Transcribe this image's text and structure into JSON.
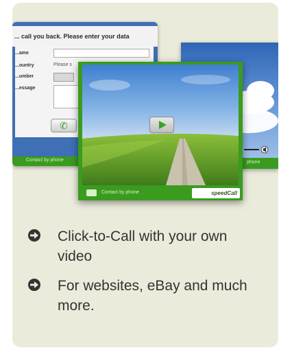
{
  "form_window": {
    "header": "... call you back. Please enter your data",
    "labels": [
      "...ame",
      "...ountry",
      "...umber",
      "...essage"
    ],
    "country_placeholder": "Please s",
    "footer_text": "Contact by phone"
  },
  "video_window": {
    "footer_text": "Contact by phone",
    "brand": "speedCall"
  },
  "sky_window": {
    "footer_text": "phone"
  },
  "features": [
    "Click-to-Call with your own video",
    "For websites, eBay and much more."
  ],
  "colors": {
    "card_bg": "#ebebdb",
    "brand_green": "#3a9b1f",
    "window_blue": "#3f6fb4",
    "text": "#333333"
  },
  "icons": {
    "bullet": "right-arrow-circle-icon",
    "call": "phone-icon",
    "play": "play-icon",
    "camera": "camera-icon",
    "volume": "volume-icon"
  }
}
